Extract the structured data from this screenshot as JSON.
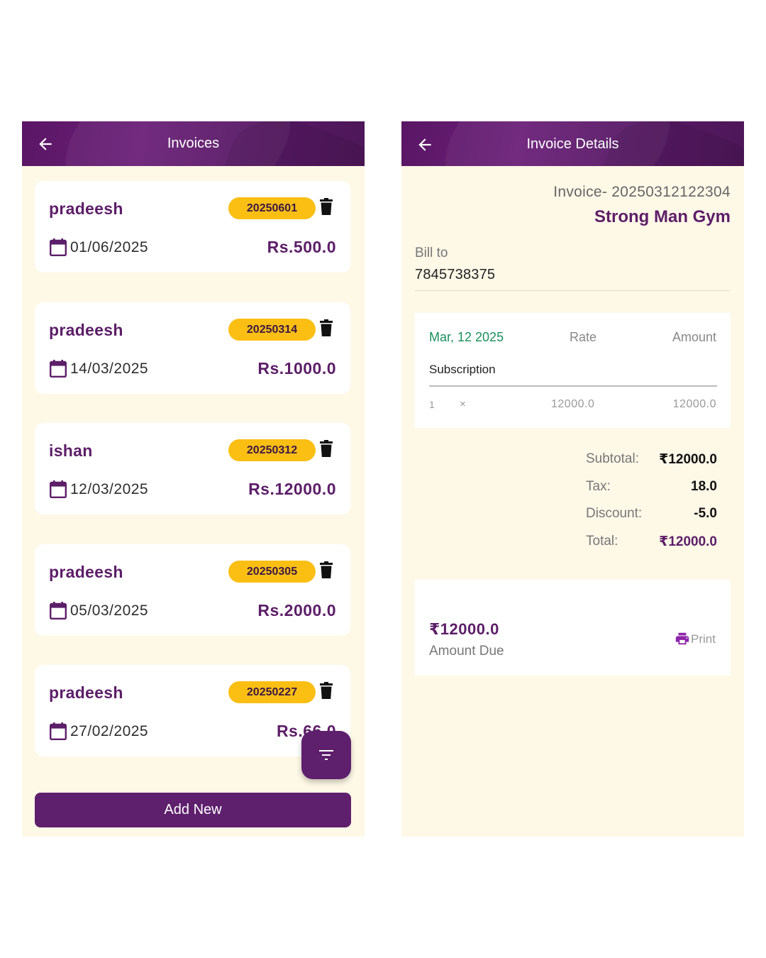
{
  "list_screen": {
    "title": "Invoices",
    "invoices": [
      {
        "customer": "pradeesh",
        "number": "20250601",
        "date": "01/06/2025",
        "amount": "Rs.500.0"
      },
      {
        "customer": "pradeesh",
        "number": "20250314",
        "date": "14/03/2025",
        "amount": "Rs.1000.0"
      },
      {
        "customer": "ishan",
        "number": "20250312",
        "date": "12/03/2025",
        "amount": "Rs.12000.0"
      },
      {
        "customer": "pradeesh",
        "number": "20250305",
        "date": "05/03/2025",
        "amount": "Rs.2000.0"
      },
      {
        "customer": "pradeesh",
        "number": "20250227",
        "date": "27/02/2025",
        "amount": "Rs.66.0"
      }
    ],
    "add_new_label": "Add New",
    "icons": {
      "back": "arrow-left-icon",
      "delete": "trash-icon",
      "date": "calendar-icon",
      "filter": "filter-icon"
    }
  },
  "detail_screen": {
    "title": "Invoice Details",
    "invoice_number": "Invoice- 20250312122304",
    "business_name": "Strong Man Gym",
    "bill_to_label": "Bill to",
    "bill_to_phone": "7845738375",
    "items_header": {
      "date": "Mar, 12 2025",
      "rate": "Rate",
      "amount": "Amount"
    },
    "items": [
      {
        "name": "Subscription",
        "qty": "1",
        "times": "×",
        "rate": "12000.0",
        "amount": "12000.0"
      }
    ],
    "summary": [
      {
        "label": "Subtotal:",
        "value": "₹12000.0"
      },
      {
        "label": "Tax:",
        "value": "18.0"
      },
      {
        "label": "Discount:",
        "value": "-5.0"
      },
      {
        "label": "Total:",
        "value": "₹12000.0"
      }
    ],
    "amount_due": "₹12000.0",
    "amount_due_label": "Amount Due",
    "print_label": "Print"
  },
  "colors": {
    "primary": "#5e1f6d",
    "badge": "#fbbf14",
    "background": "#fef8e7",
    "date_green": "#1a8f5d",
    "print_icon": "#8e24aa"
  }
}
